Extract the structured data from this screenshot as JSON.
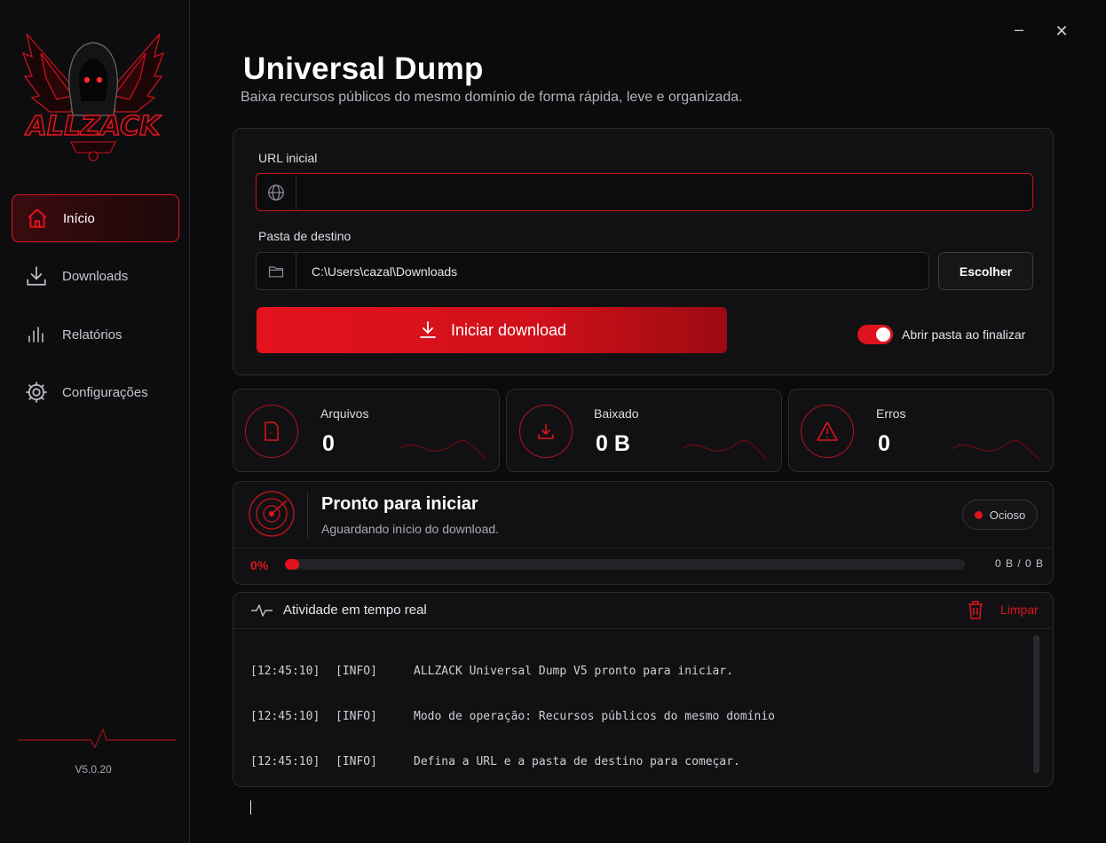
{
  "app": {
    "title": "Universal Dump",
    "subtitle": "Baixa recursos públicos do mesmo domínio de forma rápida, leve e organizada.",
    "logo_text": "ALLZACK",
    "version": "V5.0.20"
  },
  "window": {
    "minimize": "–",
    "close": "✕"
  },
  "sidebar": {
    "items": [
      {
        "label": "Início",
        "icon": "home-icon",
        "active": true
      },
      {
        "label": "Downloads",
        "icon": "download-icon",
        "active": false
      },
      {
        "label": "Relatórios",
        "icon": "bar-chart-icon",
        "active": false
      },
      {
        "label": "Configurações",
        "icon": "gear-icon",
        "active": false
      }
    ]
  },
  "form": {
    "url_label": "URL inicial",
    "url_value": "",
    "folder_label": "Pasta de destino",
    "folder_value": "C:\\Users\\cazal\\Downloads",
    "choose_label": "Escolher",
    "start_label": "Iniciar download",
    "open_folder_label": "Abrir pasta ao finalizar",
    "open_folder_enabled": true
  },
  "stats": [
    {
      "label": "Arquivos",
      "value": "0",
      "icon": "file-icon"
    },
    {
      "label": "Baixado",
      "value": "0 B",
      "icon": "download-icon"
    },
    {
      "label": "Erros",
      "value": "0",
      "icon": "warning-icon"
    }
  ],
  "status": {
    "title": "Pronto para iniciar",
    "subtitle": "Aguardando início do download.",
    "badge": "Ocioso",
    "progress_percent_label": "0%",
    "progress_fraction": 0,
    "bytes": "0 B / 0 B"
  },
  "activity": {
    "title": "Atividade em tempo real",
    "clear_label": "Limpar",
    "log": [
      {
        "time": "[12:45:10]",
        "level": "[INFO]",
        "message": "ALLZACK Universal Dump V5 pronto para iniciar."
      },
      {
        "time": "[12:45:10]",
        "level": "[INFO]",
        "message": "Modo de operação: Recursos públicos do mesmo domínio"
      },
      {
        "time": "[12:45:10]",
        "level": "[INFO]",
        "message": "Defina a URL e a pasta de destino para começar."
      }
    ]
  },
  "colors": {
    "accent": "#e0131d",
    "background": "#0b0b0d",
    "panel": "#111114"
  }
}
